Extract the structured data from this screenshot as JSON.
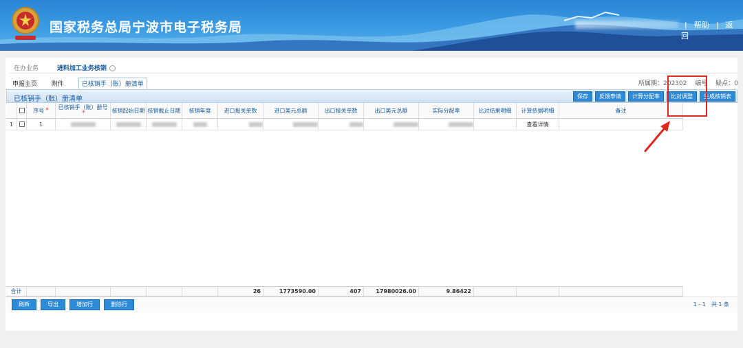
{
  "header": {
    "site_title": "国家税务总局宁波市电子税务局",
    "help_link": "帮助",
    "back_link": "返回",
    "separator": "|"
  },
  "nav_tabs": {
    "pending": "在办业务",
    "current": "进料加工业务核销"
  },
  "sub_tabs": [
    {
      "label": "申报主页"
    },
    {
      "label": "附件"
    },
    {
      "label": "已核销手（账）册清单"
    }
  ],
  "period_info": "所属期：202302 　编号　 疑点：0",
  "list": {
    "title": "已核销手（账）册清单",
    "buttons": [
      "保存",
      "反馈申请",
      "计算分配率",
      "比对调整",
      "生成核销表"
    ]
  },
  "table": {
    "columns": [
      "序号",
      "已核销手（账）册号",
      "核销起始日期",
      "核销截止日期",
      "核销年度",
      "进口报关单数",
      "进口美元总额",
      "出口报关单数",
      "出口美元总额",
      "实际分配率",
      "比对结果明细",
      "计算依据明细",
      "备注"
    ],
    "rows": [
      {
        "row_num": "1",
        "seq": "1",
        "detail_link": "查看详情"
      }
    ],
    "totals": {
      "label": "合计",
      "import_count": "26",
      "import_usd": "1773590.00",
      "export_count": "407",
      "export_usd": "17980026.00",
      "ratio": "9.86422"
    }
  },
  "bottom_buttons": [
    "刷新",
    "导出",
    "增加行",
    "删除行"
  ],
  "pager": "1 - 1　共 1 条",
  "colors": {
    "accent": "#2c8ad6",
    "highlight": "#e0281f",
    "link": "#1b5ea6"
  }
}
